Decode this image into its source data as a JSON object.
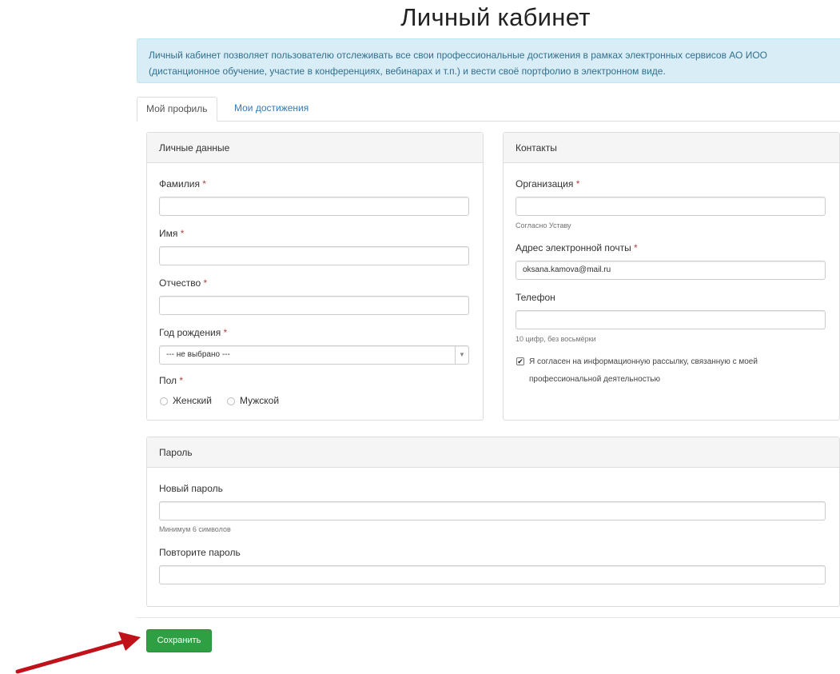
{
  "page": {
    "title": "Личный кабинет",
    "info_line1": "Личный кабинет позволяет пользователю отслеживать все свои профессиональные достижения в рамках электронных сервисов АО ИОО",
    "info_line2": "(дистанционное обучение, участие в конференциях, вебинарах и т.п.) и вести своё портфолио в электронном виде."
  },
  "tabs": [
    {
      "label": "Мой профиль",
      "active": true
    },
    {
      "label": "Мои достижения",
      "active": false
    }
  ],
  "personal": {
    "heading": "Личные данные",
    "surname_label": "Фамилия",
    "name_label": "Имя",
    "patronymic_label": "Отчество",
    "birth_year_label": "Год рождения",
    "birth_year_value": "--- не выбрано ---",
    "gender_label": "Пол",
    "gender_options": [
      "Женский",
      "Мужской"
    ],
    "required_mark": "*"
  },
  "contacts": {
    "heading": "Контакты",
    "org_label": "Организация",
    "org_help": "Согласно Уставу",
    "email_label": "Адрес электронной почты",
    "email_value": "oksana.kamova@mail.ru",
    "phone_label": "Телефон",
    "phone_help": "10 цифр, без восьмёрки",
    "consent_line1": "Я согласен на информационную рассылку, связанную с моей",
    "consent_line2": "профессиональной деятельностью",
    "consent_checked": true,
    "required_mark": "*"
  },
  "password": {
    "heading": "Пароль",
    "new_label": "Новый пароль",
    "new_help": "Минимум 6 символов",
    "repeat_label": "Повторите пароль"
  },
  "actions": {
    "save_label": "Сохранить"
  },
  "colors": {
    "info_bg": "#d9edf7",
    "save_button": "#2ea043",
    "arrow": "#c0121a",
    "link": "#337ab7"
  },
  "icons": {
    "select_arrow": "caret-down-icon",
    "pointer": "red-arrow-icon"
  }
}
